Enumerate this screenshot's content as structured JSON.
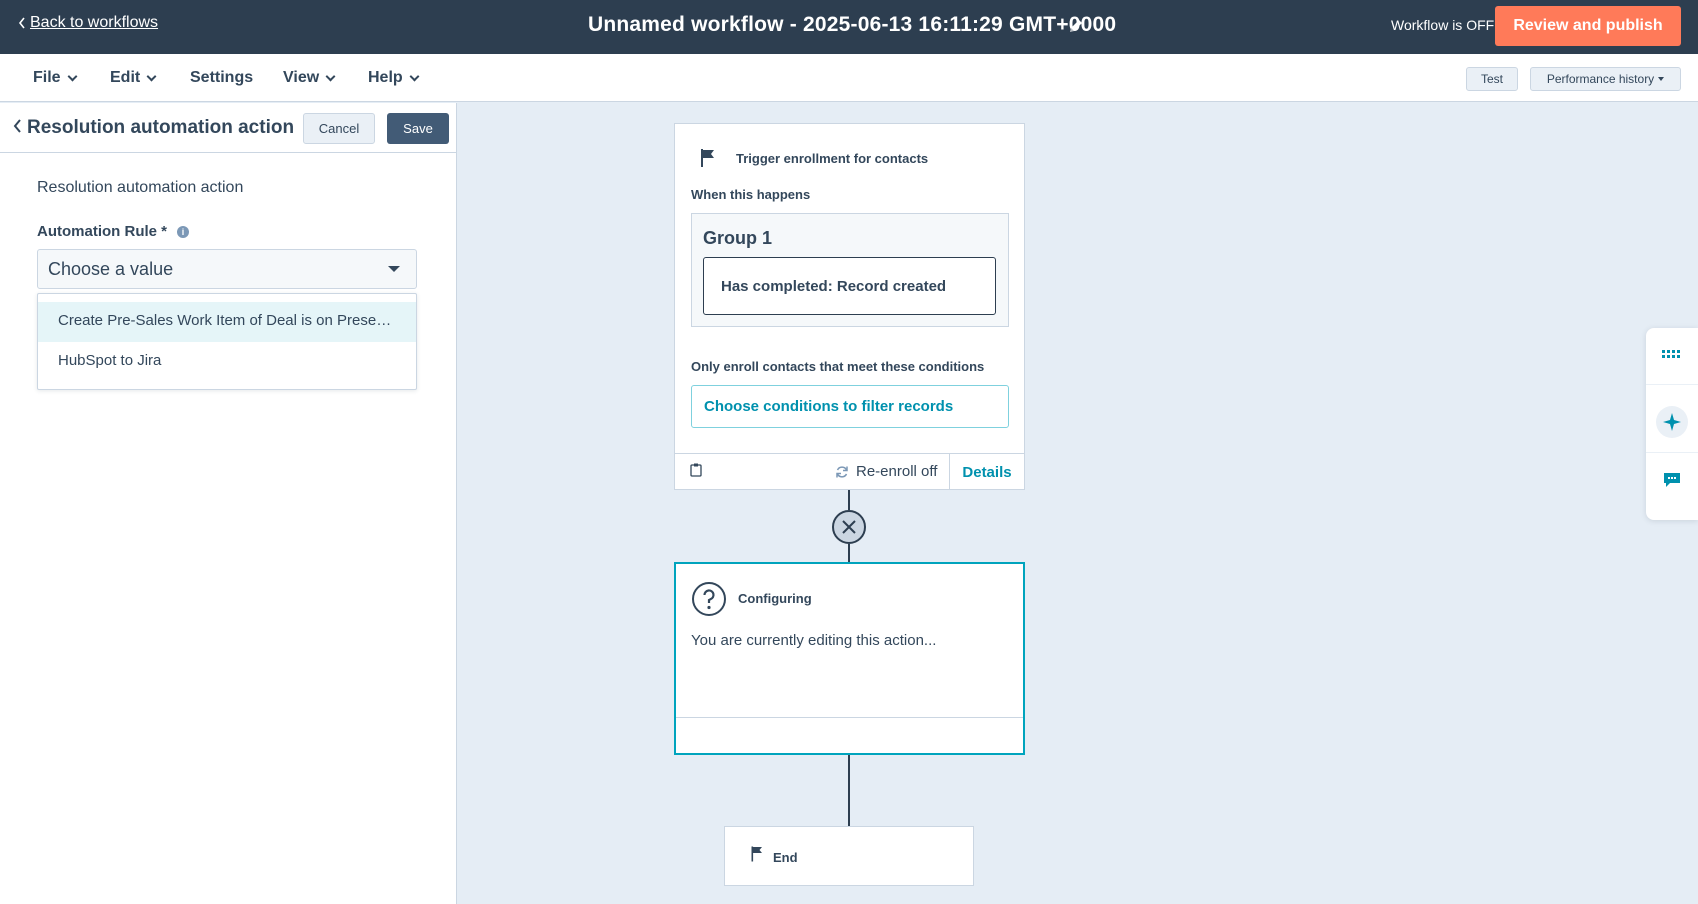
{
  "topbar": {
    "back_label": "Back to workflows",
    "workflow_title": "Unnamed workflow - 2025-06-13 16:11:29 GMT+0000",
    "status": "Workflow is OFF",
    "publish_label": "Review and publish"
  },
  "menu": {
    "items": [
      {
        "label": "File"
      },
      {
        "label": "Edit"
      },
      {
        "label": "Settings"
      },
      {
        "label": "View"
      },
      {
        "label": "Help"
      }
    ],
    "test_label": "Test",
    "performance_label": "Performance history"
  },
  "panel": {
    "title": "Resolution automation action",
    "cancel_label": "Cancel",
    "save_label": "Save",
    "section_label": "Resolution automation action",
    "field_label": "Automation Rule *",
    "select_placeholder": "Choose a value",
    "options": [
      {
        "label": "Create Pre-Sales Work Item of Deal is on Present..."
      },
      {
        "label": "HubSpot to Jira"
      }
    ]
  },
  "trigger": {
    "title": "Trigger enrollment for contacts",
    "when_label": "When this happens",
    "group_title": "Group 1",
    "filter_text": "Has completed: Record created",
    "only_label": "Only enroll contacts that meet these conditions",
    "choose_conditions": "Choose conditions to filter records",
    "reenroll_label": "Re-enroll off",
    "details_label": "Details"
  },
  "config": {
    "title": "Configuring",
    "text": "You are currently editing this action..."
  },
  "end": {
    "label": "End"
  },
  "colors": {
    "topbar": "#2d3e50",
    "accent": "#ff7a59",
    "link": "#0091ae",
    "selected_border": "#00a4bd"
  }
}
